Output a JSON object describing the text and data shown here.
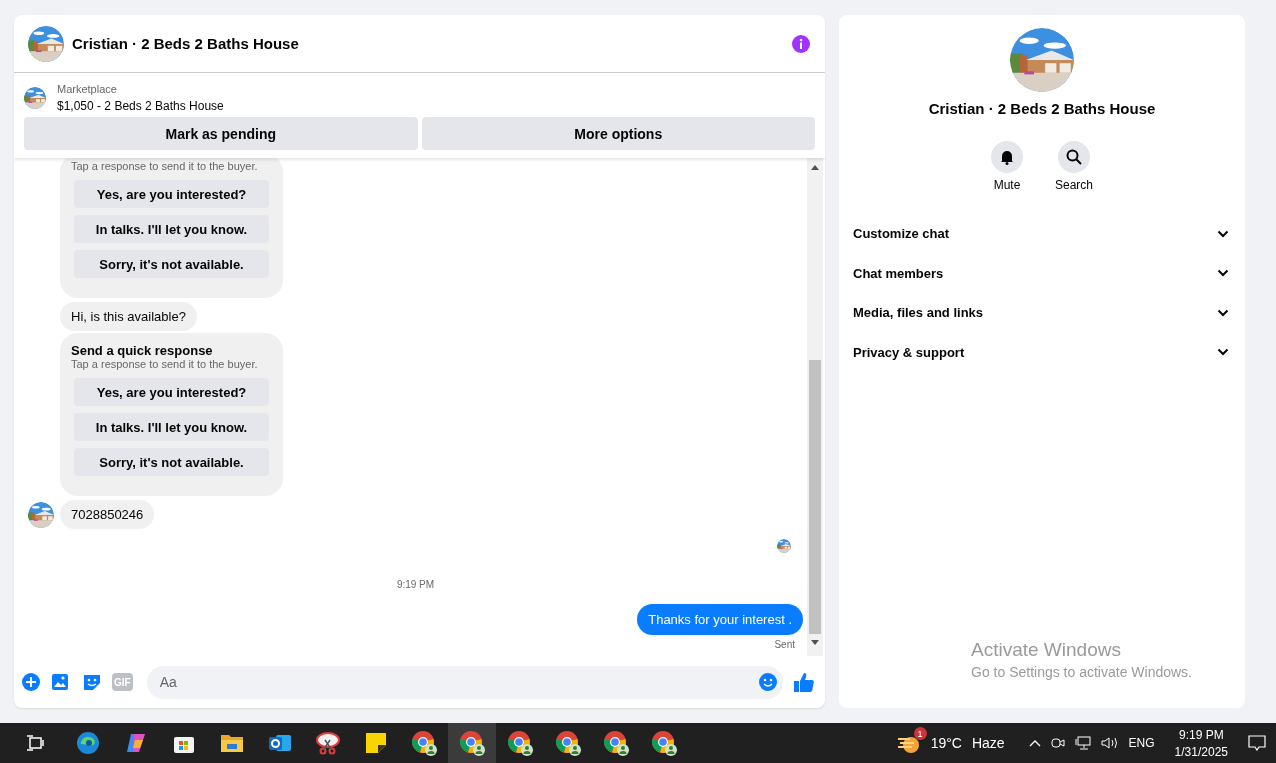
{
  "chat": {
    "title": "Cristian · 2 Beds 2 Baths House",
    "listing": {
      "source": "Marketplace",
      "summary": "$1,050 - 2 Beds 2 Baths House"
    },
    "actions": [
      "Mark as pending",
      "More options"
    ],
    "messages": [
      {
        "kind": "quick_response",
        "subtitle": "Tap a response to send it to the buyer.",
        "options": [
          "Yes, are you interested?",
          "In talks. I'll let you know.",
          "Sorry, it's not available."
        ]
      },
      {
        "kind": "incoming",
        "text": "Hi, is this available?",
        "avatar": false
      },
      {
        "kind": "quick_response",
        "title": "Send a quick response",
        "subtitle": "Tap a response to send it to the buyer.",
        "options": [
          "Yes, are you interested?",
          "In talks. I'll let you know.",
          "Sorry, it's not available."
        ]
      },
      {
        "kind": "incoming",
        "text": "7028850246",
        "avatar": true
      },
      {
        "kind": "read_receipt"
      },
      {
        "kind": "timestamp",
        "text": "9:19 PM"
      },
      {
        "kind": "outgoing",
        "text": "Thanks for your interest .",
        "status": "Sent"
      }
    ],
    "composer": {
      "gif_label": "GIF",
      "placeholder": "Aa"
    }
  },
  "details": {
    "title": "Cristian · 2 Beds 2 Baths House",
    "actions": [
      {
        "kind": "bell",
        "label": "Mute"
      },
      {
        "kind": "search",
        "label": "Search"
      }
    ],
    "sections": [
      {
        "label": "Customize chat",
        "expanded": false
      },
      {
        "label": "Chat members",
        "expanded": false
      },
      {
        "label": "Media, files and links",
        "expanded": false
      },
      {
        "label": "Privacy & support",
        "expanded": false
      }
    ],
    "activation_notice": {
      "title": "Activate Windows",
      "text": "Go to Settings to activate Windows."
    }
  },
  "taskbar": {
    "apps": [
      {
        "kind": "task_view",
        "selected": false
      },
      {
        "kind": "edge",
        "selected": false
      },
      {
        "kind": "copilot",
        "selected": false
      },
      {
        "kind": "store",
        "selected": false
      },
      {
        "kind": "files",
        "selected": false
      },
      {
        "kind": "outlook",
        "selected": false
      },
      {
        "kind": "snipping",
        "selected": false
      },
      {
        "kind": "sticky",
        "selected": false
      },
      {
        "kind": "chrome",
        "selected": false
      },
      {
        "kind": "chrome",
        "selected": true
      },
      {
        "kind": "chrome",
        "selected": false
      },
      {
        "kind": "chrome",
        "selected": false
      },
      {
        "kind": "chrome",
        "selected": false
      },
      {
        "kind": "chrome",
        "selected": false
      }
    ],
    "weather": {
      "badge": "1",
      "temperature": "19°C",
      "condition": "Haze"
    },
    "language": "ENG",
    "time": "9:19 PM",
    "date": "1/31/2025"
  }
}
